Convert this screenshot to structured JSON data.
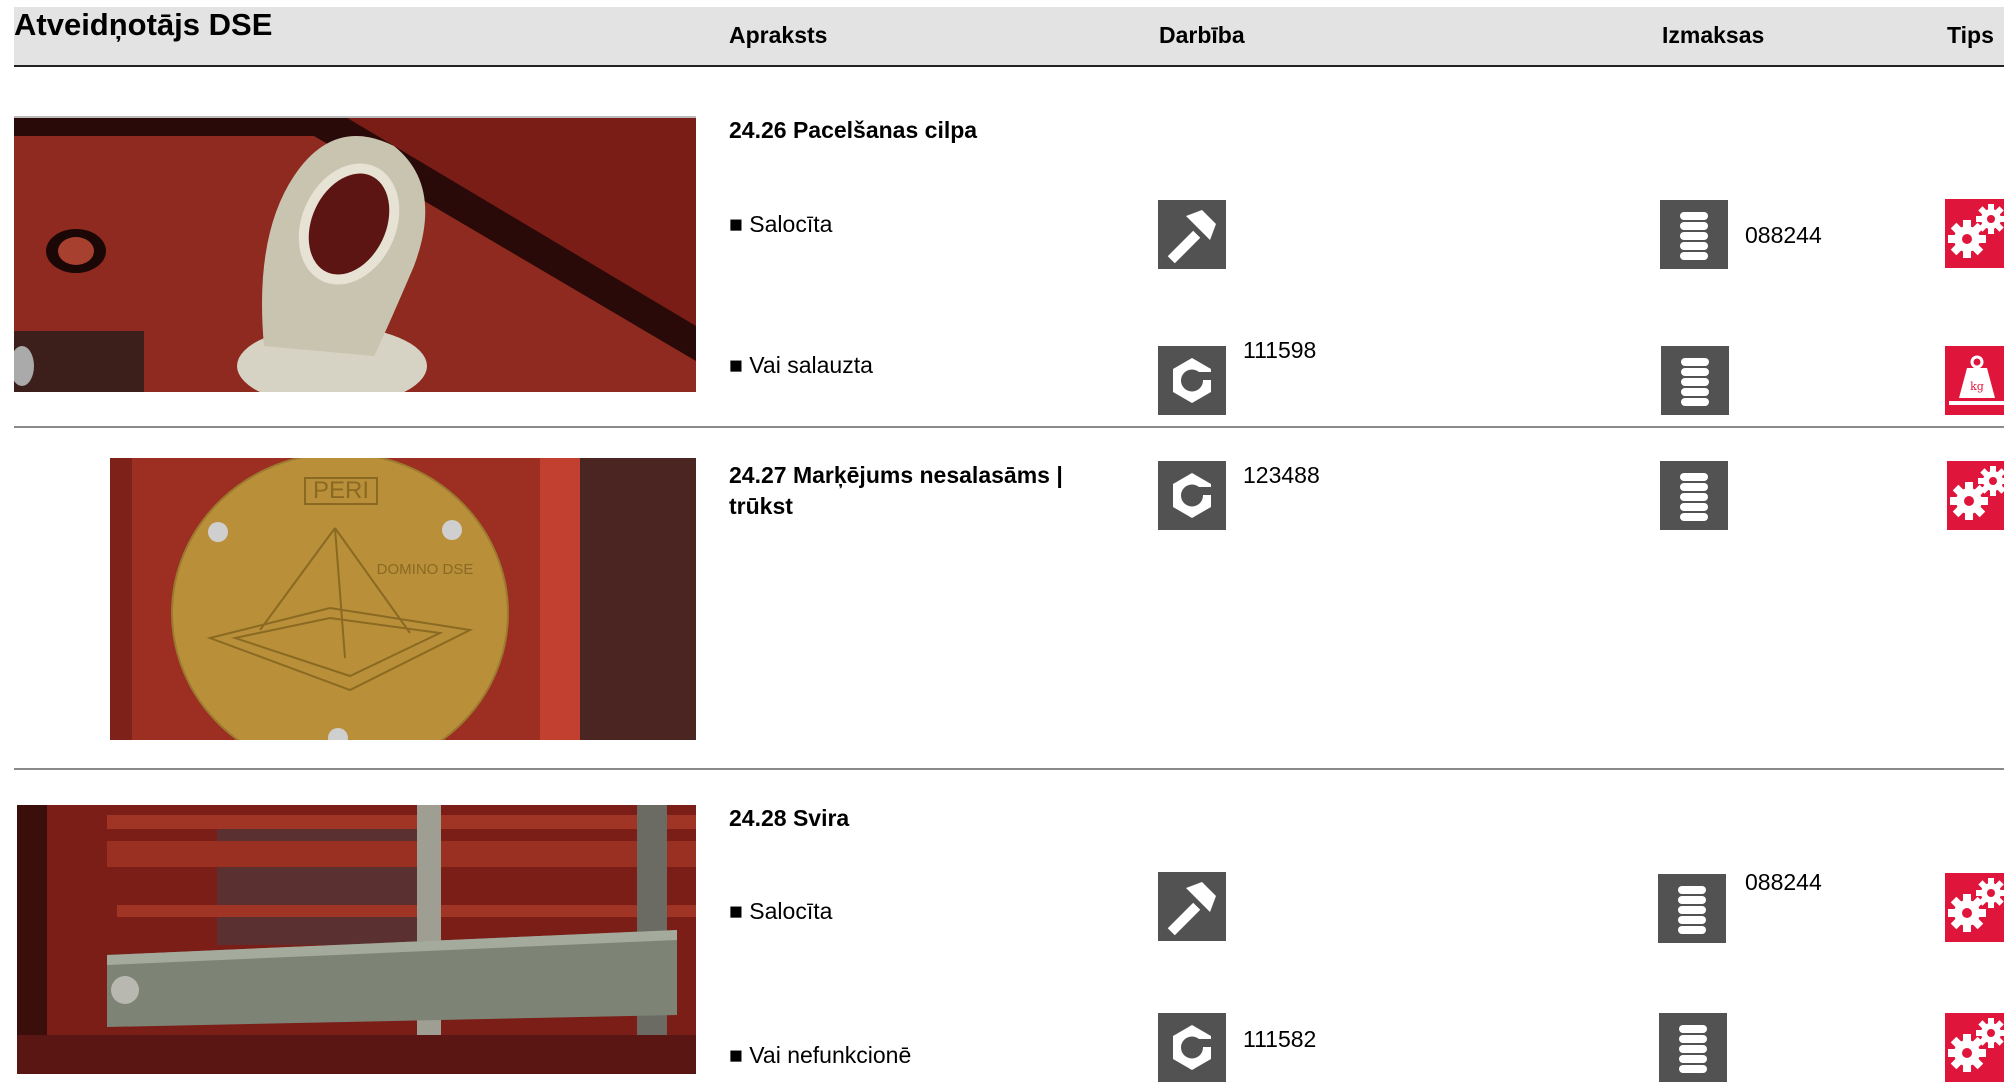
{
  "header": {
    "title": "Atveidņotājs DSE",
    "columns": {
      "description": "Apraksts",
      "action": "Darbība",
      "costs": "Izmaksas",
      "tips": "Tips"
    }
  },
  "sections": [
    {
      "title": "24.26 Pacelšanas cilpa",
      "image": "lifting-eye-photo",
      "items": [
        {
          "text": "■ Salocīta",
          "action_icon": "hammer-icon",
          "action_code": "",
          "cost_icon": "coin-stack-icon",
          "cost_code": "088244",
          "tip_icon": "gears-icon"
        },
        {
          "text": "■ Vai salauzta",
          "action_icon": "hex-nut-icon",
          "action_code": "111598",
          "cost_icon": "coin-stack-icon",
          "cost_code": "",
          "tip_icon": "weight-kg-icon"
        }
      ]
    },
    {
      "title": "24.27 Marķējums nesalasāms | trūkst",
      "image": "marking-plate-photo",
      "plate_text": {
        "brand": "PERI",
        "product": "DOMINO DSE"
      },
      "items": [
        {
          "text": "",
          "action_icon": "hex-nut-icon",
          "action_code": "123488",
          "cost_icon": "coin-stack-icon",
          "cost_code": "",
          "tip_icon": "gears-icon"
        }
      ]
    },
    {
      "title": "24.28 Svira",
      "image": "lever-photo",
      "items": [
        {
          "text": "■ Salocīta",
          "action_icon": "hammer-icon",
          "action_code": "",
          "cost_icon": "coin-stack-icon",
          "cost_code": "088244",
          "tip_icon": "gears-icon"
        },
        {
          "text": "■ Vai nefunkcionē",
          "action_icon": "hex-nut-icon",
          "action_code": "111582",
          "cost_icon": "coin-stack-icon",
          "cost_code": "",
          "tip_icon": "gears-icon"
        }
      ]
    }
  ],
  "colors": {
    "header_bg": "#e3e3e3",
    "icon_bg": "#525252",
    "tip_bg": "#e0153c",
    "divider": "#8a8a8a"
  }
}
